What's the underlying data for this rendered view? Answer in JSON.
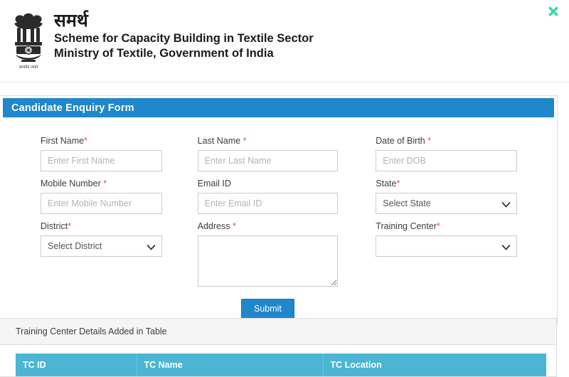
{
  "header": {
    "emblem_icon": "ashoka-lion-capital-emblem",
    "emblem_motto": "सत्यमेव जयते",
    "hindi_title": "समर्थ",
    "english_line1": "Scheme for Capacity Building in Textile Sector",
    "english_line2": "Ministry of Textile, Government of India",
    "close_icon": "close-icon",
    "close_icon_color": "#3ed6a8"
  },
  "panel": {
    "title": "Candidate Enquiry Form",
    "header_color": "#1f87cc"
  },
  "form": {
    "fields": {
      "first_name": {
        "label": "First Name",
        "required": true,
        "placeholder": "Enter First Name",
        "value": ""
      },
      "last_name": {
        "label": "Last Name",
        "required": true,
        "placeholder": "Enter Last Name",
        "value": ""
      },
      "dob": {
        "label": "Date of Birth",
        "required": true,
        "placeholder": "Enter DOB",
        "value": ""
      },
      "mobile": {
        "label": "Mobile Number",
        "required": true,
        "placeholder": "Enter Mobile Number",
        "value": ""
      },
      "email": {
        "label": "Email ID",
        "required": false,
        "placeholder": "Enter Email ID",
        "value": ""
      },
      "state": {
        "label": "State",
        "required": true,
        "selected": "Select State",
        "options": [
          "Select State"
        ]
      },
      "district": {
        "label": "District",
        "required": true,
        "selected": "Select District",
        "options": [
          "Select District"
        ]
      },
      "address": {
        "label": "Address",
        "required": true,
        "placeholder": "",
        "value": ""
      },
      "training_center": {
        "label": "Training Center",
        "required": true,
        "selected": "",
        "options": [
          ""
        ]
      }
    },
    "submit_label": "Submit"
  },
  "table_section": {
    "caption": "Training Center Details Added in Table",
    "header_color": "#4cb5d4",
    "columns": [
      "TC ID",
      "TC Name",
      "TC Location"
    ],
    "rows": []
  }
}
